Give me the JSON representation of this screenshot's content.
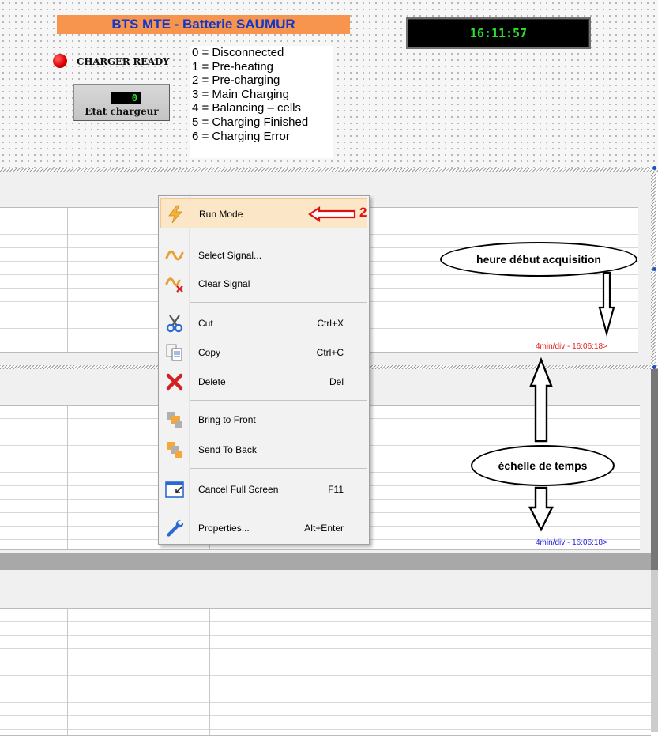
{
  "header": {
    "title": "BTS MTE - Batterie SAUMUR",
    "clock": "16:11:57",
    "charger_status": "CHARGER READY",
    "state_value": "0",
    "state_label": "Etat chargeur",
    "legend": [
      "0 = Disconnected",
      "1 = Pre-heating",
      "2 = Pre-charging",
      "3 = Main Charging",
      "4 = Balancing – cells",
      "5 = Charging Finished",
      "6 = Charging Error"
    ]
  },
  "charts": {
    "chart1_timescale": "4min/div - 16:06:18>",
    "chart2_timescale": "4min/div - 16:06:18>"
  },
  "context_menu": {
    "items": [
      {
        "label": "Run Mode",
        "shortcut": "",
        "icon": "lightning-icon"
      },
      {
        "label": "Select Signal...",
        "shortcut": "",
        "icon": "signal-wave-icon"
      },
      {
        "label": "Clear Signal",
        "shortcut": "",
        "icon": "clear-signal-icon"
      },
      {
        "label": "Cut",
        "shortcut": "Ctrl+X",
        "icon": "scissors-icon"
      },
      {
        "label": "Copy",
        "shortcut": "Ctrl+C",
        "icon": "copy-icon"
      },
      {
        "label": "Delete",
        "shortcut": "Del",
        "icon": "delete-x-icon"
      },
      {
        "label": "Bring to Front",
        "shortcut": "",
        "icon": "bring-to-front-icon"
      },
      {
        "label": "Send To Back",
        "shortcut": "",
        "icon": "send-to-back-icon"
      },
      {
        "label": "Cancel Full Screen",
        "shortcut": "F11",
        "icon": "cancel-full-screen-icon"
      },
      {
        "label": "Properties...",
        "shortcut": "Alt+Enter",
        "icon": "wrench-icon"
      }
    ]
  },
  "annotations": {
    "step_number": "2",
    "start_time_label": "heure début acquisition",
    "time_scale_label": "échelle de temps"
  },
  "colors": {
    "title_bg": "#f7944e",
    "title_text": "#1338c8",
    "clock_text": "#2ee02e",
    "led": "#e00000",
    "chart1_scale": "#e02020",
    "chart2_scale": "#2020e0",
    "menu_highlight": "#fce6c8",
    "annotation_arrow": "#e01010"
  }
}
